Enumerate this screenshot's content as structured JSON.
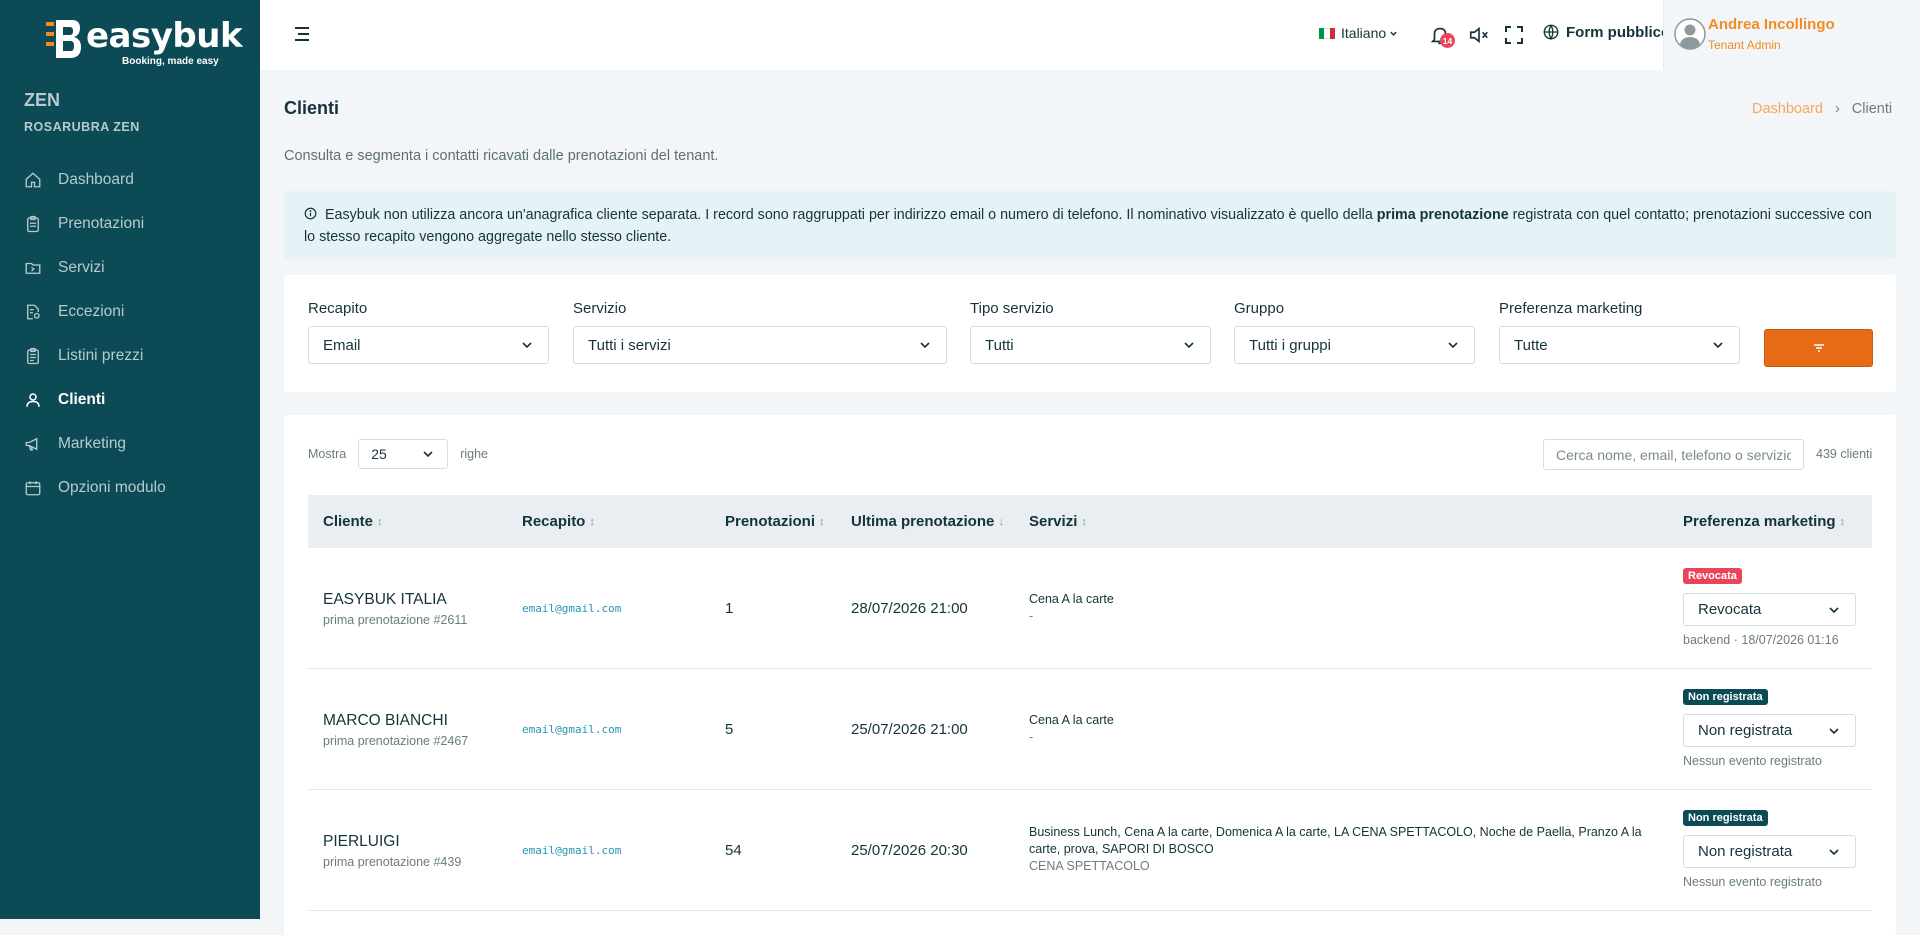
{
  "brand": {
    "name": "easybuk",
    "tagline": "Booking, made easy"
  },
  "sidebar": {
    "tenant": "ZEN",
    "tenant_sub": "ROSARUBRA ZEN",
    "items": [
      {
        "label": "Dashboard",
        "icon": "home-icon"
      },
      {
        "label": "Prenotazioni",
        "icon": "clipboard-icon"
      },
      {
        "label": "Servizi",
        "icon": "folder-icon"
      },
      {
        "label": "Eccezioni",
        "icon": "document-gear-icon"
      },
      {
        "label": "Listini prezzi",
        "icon": "clipboard-list-icon"
      },
      {
        "label": "Clienti",
        "icon": "user-icon",
        "active": true
      },
      {
        "label": "Marketing",
        "icon": "megaphone-icon"
      },
      {
        "label": "Opzioni modulo",
        "icon": "calendar-icon"
      }
    ]
  },
  "topbar": {
    "language": "Italiano",
    "notifications": "14",
    "public_form": "Form pubblico",
    "user_name": "Andrea Incollingo",
    "user_role": "Tenant Admin"
  },
  "page": {
    "title": "Clienti",
    "breadcrumb_home": "Dashboard",
    "breadcrumb_current": "Clienti",
    "description": "Consulta e segmenta i contatti ricavati dalle prenotazioni del tenant.",
    "info_before": "Easybuk non utilizza ancora un'anagrafica cliente separata. I record sono raggruppati per indirizzo email o numero di telefono. Il nominativo visualizzato è quello della ",
    "info_bold": "prima prenotazione",
    "info_after": " registrata con quel contatto; prenotazioni successive con lo stesso recapito vengono aggregate nello stesso cliente."
  },
  "filters": {
    "recapito": {
      "label": "Recapito",
      "value": "Email"
    },
    "servizio": {
      "label": "Servizio",
      "value": "Tutti i servizi"
    },
    "tipo": {
      "label": "Tipo servizio",
      "value": "Tutti"
    },
    "gruppo": {
      "label": "Gruppo",
      "value": "Tutti i gruppi"
    },
    "marketing": {
      "label": "Preferenza marketing",
      "value": "Tutte"
    }
  },
  "table": {
    "show_label": "Mostra",
    "page_size": "25",
    "rows_label": "righe",
    "search_placeholder": "Cerca nome, email, telefono o servizio",
    "count": "439 clienti",
    "columns": [
      "Cliente",
      "Recapito",
      "Prenotazioni",
      "Ultima prenotazione",
      "Servizi",
      "Preferenza marketing"
    ],
    "sort_icons": [
      "↕",
      "↕",
      "↕",
      "↓",
      "↕",
      "↕"
    ],
    "rows": [
      {
        "name": "EASYBUK ITALIA",
        "sub": "prima prenotazione #2611",
        "email": "email@gmail.com",
        "bookings": "1",
        "last": "28/07/2026 21:00",
        "services": "Cena A la carte",
        "services_extra": "-",
        "badge": "Revocata",
        "badge_color": "#e8455a",
        "pref": "Revocata",
        "note": "backend · 18/07/2026 01:16"
      },
      {
        "name": "MARCO BIANCHI",
        "sub": "prima prenotazione #2467",
        "email": "email@gmail.com",
        "bookings": "5",
        "last": "25/07/2026 21:00",
        "services": "Cena A la carte",
        "services_extra": "-",
        "badge": "Non registrata",
        "badge_color": "#0c4a55",
        "pref": "Non registrata",
        "note": "Nessun evento registrato"
      },
      {
        "name": "PIERLUIGI",
        "sub": "prima prenotazione #439",
        "email": "email@gmail.com",
        "bookings": "54",
        "last": "25/07/2026 20:30",
        "services": "Business Lunch, Cena A la carte, Domenica A la carte, LA CENA SPETTACOLO, Noche de Paella, Pranzo A la carte, prova, SAPORI DI BOSCO",
        "services_extra": "CENA SPETTACOLO",
        "badge": "Non registrata",
        "badge_color": "#0c4a55",
        "pref": "Non registrata",
        "note": "Nessun evento registrato"
      }
    ]
  }
}
